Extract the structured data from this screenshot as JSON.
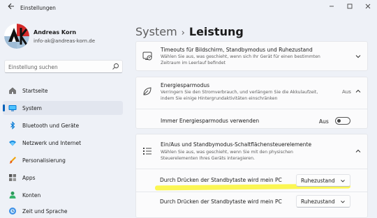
{
  "window": {
    "title": "Einstellungen"
  },
  "user": {
    "name": "Andreas Korn",
    "email": "info-ak@andreas-korn.de"
  },
  "search": {
    "placeholder": "Einstellung suchen"
  },
  "sidebar": {
    "items": [
      {
        "label": "Startseite",
        "icon": "home-icon"
      },
      {
        "label": "System",
        "icon": "monitor-icon",
        "active": true
      },
      {
        "label": "Bluetooth und Geräte",
        "icon": "bluetooth-icon"
      },
      {
        "label": "Netzwerk und Internet",
        "icon": "wifi-icon"
      },
      {
        "label": "Personalisierung",
        "icon": "brush-icon"
      },
      {
        "label": "Apps",
        "icon": "apps-icon"
      },
      {
        "label": "Konten",
        "icon": "person-icon"
      },
      {
        "label": "Zeit und Sprache",
        "icon": "globe-clock-icon"
      }
    ]
  },
  "breadcrumb": {
    "parent": "System",
    "separator": "›",
    "current": "Leistung"
  },
  "cards": {
    "timeouts": {
      "title": "Timeouts für Bildschirm, Standbymodus und Ruhezustand",
      "description": "Wählen Sie aus, was geschieht, wenn sich Ihr Gerät für einen bestimmten Zeitraum im Leerlauf befindet"
    },
    "energy": {
      "title": "Energiesparmodus",
      "description": "Verringern Sie den Stromverbrauch, und verlängern Sie die Akkulaufzeit, indem Sie einige Hintergrundaktivitäten einschränken",
      "value": "Aus",
      "always_label": "Immer Energiesparmodus verwenden",
      "always_value": "Aus"
    },
    "power_buttons": {
      "title": "Ein/Aus und Standbymodus-Schaltflächensteuerelemente",
      "description": "Wählen Sie aus, was geschieht, wenn Sie mit den physischen Steuerelementen Ihres Geräts interagieren.",
      "rows": [
        {
          "label": "Durch Drücken der Standbytaste wird mein PC",
          "value": "Ruhezustand"
        },
        {
          "label": "Durch Drücken der Standbytaste wird mein PC",
          "value": "Ruhezustand"
        }
      ]
    }
  },
  "colors": {
    "accent": "#005fb8",
    "highlight": "#fbf54a",
    "background": "#eef1f7"
  }
}
